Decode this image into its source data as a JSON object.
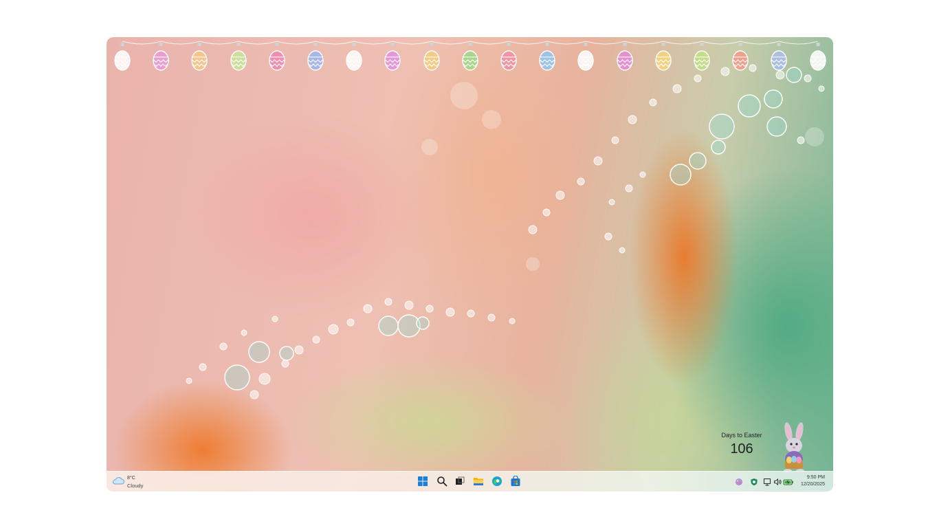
{
  "desktop": {
    "garland_egg_colors": [
      "#ffffff",
      "#e79ad3",
      "#f5c98a",
      "#c9e39a",
      "#ee87b0",
      "#9bb6ee",
      "#ffffff",
      "#e392dc",
      "#f2cf7f",
      "#9cdb89",
      "#ef8fa6",
      "#8fc8ee",
      "#ffffff",
      "#e58ad5",
      "#f4d57a",
      "#c2e084",
      "#f39a8a",
      "#a9bde8",
      "#ffffff"
    ],
    "countdown": {
      "label": "Days to Easter",
      "value": "106"
    },
    "bunny_icon": "easter-bunny-icon"
  },
  "taskbar": {
    "weather": {
      "temperature": "8°C",
      "condition": "Cloudy",
      "icon": "cloud-icon"
    },
    "apps": [
      {
        "name": "start",
        "icon": "windows-start-icon"
      },
      {
        "name": "search",
        "icon": "search-icon"
      },
      {
        "name": "task-view",
        "icon": "task-view-icon"
      },
      {
        "name": "file-explorer",
        "icon": "folder-icon"
      },
      {
        "name": "edge",
        "icon": "edge-browser-icon"
      },
      {
        "name": "store",
        "icon": "store-icon"
      }
    ],
    "tray": {
      "icons": [
        "palette-icon",
        "shield-icon",
        "network-icon",
        "volume-icon",
        "battery-icon"
      ],
      "time": "9:50 PM",
      "date": "12/20/2025"
    }
  }
}
